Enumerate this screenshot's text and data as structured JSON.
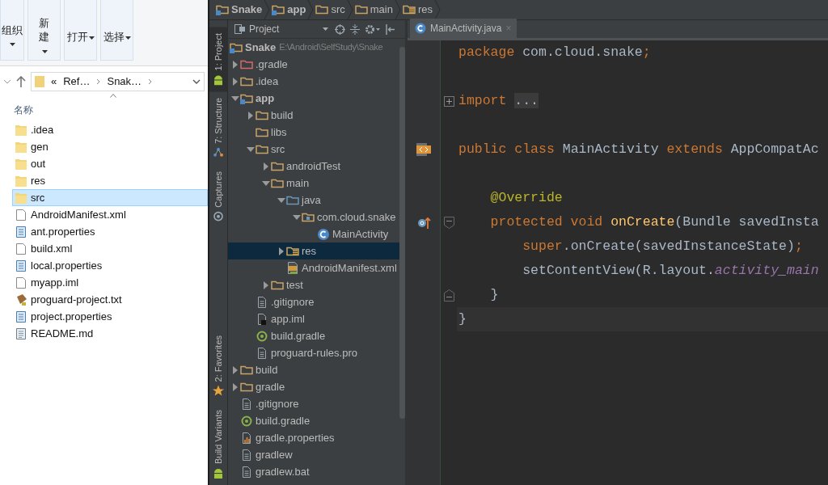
{
  "explorer": {
    "ribbon": [
      {
        "label": "组织"
      },
      {
        "label": "新建"
      },
      {
        "label": "打开"
      },
      {
        "label": "选择"
      }
    ],
    "address": {
      "prefix": "«",
      "parts": [
        "Ref…",
        "Snak…"
      ]
    },
    "column_header": "名称",
    "files": [
      {
        "name": ".idea",
        "kind": "folder",
        "selected": false
      },
      {
        "name": "gen",
        "kind": "folder",
        "selected": false
      },
      {
        "name": "out",
        "kind": "folder",
        "selected": false
      },
      {
        "name": "res",
        "kind": "folder",
        "selected": false
      },
      {
        "name": "src",
        "kind": "folder",
        "selected": true
      },
      {
        "name": "AndroidManifest.xml",
        "kind": "file",
        "selected": false
      },
      {
        "name": "ant.properties",
        "kind": "settings",
        "selected": false
      },
      {
        "name": "build.xml",
        "kind": "file",
        "selected": false
      },
      {
        "name": "local.properties",
        "kind": "settings",
        "selected": false
      },
      {
        "name": "myapp.iml",
        "kind": "file",
        "selected": false
      },
      {
        "name": "proguard-project.txt",
        "kind": "script",
        "selected": false
      },
      {
        "name": "project.properties",
        "kind": "settings",
        "selected": false
      },
      {
        "name": "README.md",
        "kind": "text",
        "selected": false
      }
    ]
  },
  "ide": {
    "breadcrumbs": [
      {
        "label": "Snake",
        "kind": "module"
      },
      {
        "label": "app",
        "kind": "module"
      },
      {
        "label": "src",
        "kind": "folder"
      },
      {
        "label": "main",
        "kind": "folder"
      },
      {
        "label": "res",
        "kind": "res"
      }
    ],
    "tool_tabs": [
      {
        "label": "1: Project",
        "selected": true
      },
      {
        "label": "7: Structure",
        "selected": false
      },
      {
        "label": "Captures",
        "selected": false
      },
      {
        "label": "2: Favorites",
        "selected": false
      },
      {
        "label": "Build Variants",
        "selected": false
      }
    ],
    "project_view": {
      "title": "Project",
      "tree": [
        {
          "label": "Snake",
          "path": "E:\\Android\\SelfStudy\\Snake",
          "kind": "module",
          "selected": false,
          "children": [
            {
              "label": ".gradle",
              "kind": "excluded",
              "expanded": false,
              "selected": false
            },
            {
              "label": ".idea",
              "kind": "folder",
              "expanded": false,
              "selected": false
            },
            {
              "label": "app",
              "kind": "module",
              "expanded": true,
              "selected": false,
              "children": [
                {
                  "label": "build",
                  "kind": "folder",
                  "expanded": false,
                  "selected": false
                },
                {
                  "label": "libs",
                  "kind": "folder",
                  "selected": false
                },
                {
                  "label": "src",
                  "kind": "folder",
                  "expanded": true,
                  "selected": false,
                  "children": [
                    {
                      "label": "androidTest",
                      "kind": "folder",
                      "expanded": false,
                      "selected": false
                    },
                    {
                      "label": "main",
                      "kind": "folder",
                      "expanded": true,
                      "selected": false,
                      "children": [
                        {
                          "label": "java",
                          "kind": "source",
                          "expanded": true,
                          "selected": false,
                          "children": [
                            {
                              "label": "com.cloud.snake",
                              "kind": "package",
                              "expanded": true,
                              "selected": false,
                              "children": [
                                {
                                  "label": "MainActivity",
                                  "kind": "class",
                                  "selected": false
                                }
                              ]
                            }
                          ]
                        },
                        {
                          "label": "res",
                          "kind": "res",
                          "expanded": false,
                          "selected": true
                        },
                        {
                          "label": "AndroidManifest.xml",
                          "kind": "manifest",
                          "selected": false
                        }
                      ]
                    },
                    {
                      "label": "test",
                      "kind": "folder",
                      "expanded": false,
                      "selected": false
                    }
                  ]
                },
                {
                  "label": ".gitignore",
                  "kind": "file",
                  "selected": false
                },
                {
                  "label": "app.iml",
                  "kind": "iml",
                  "selected": false
                },
                {
                  "label": "build.gradle",
                  "kind": "gradle",
                  "selected": false
                },
                {
                  "label": "proguard-rules.pro",
                  "kind": "file",
                  "selected": false
                }
              ]
            },
            {
              "label": "build",
              "kind": "folder",
              "expanded": false,
              "selected": false
            },
            {
              "label": "gradle",
              "kind": "folder",
              "expanded": false,
              "selected": false
            },
            {
              "label": ".gitignore",
              "kind": "file",
              "selected": false
            },
            {
              "label": "build.gradle",
              "kind": "gradle",
              "selected": false
            },
            {
              "label": "gradle.properties",
              "kind": "properties",
              "selected": false
            },
            {
              "label": "gradlew",
              "kind": "file",
              "selected": false
            },
            {
              "label": "gradlew.bat",
              "kind": "file",
              "selected": false
            }
          ]
        }
      ]
    },
    "editor": {
      "tabs": [
        {
          "label": "MainActivity.java",
          "close": "×",
          "selected": true
        }
      ],
      "lines": [
        {
          "kind": "code",
          "current": false,
          "tokens": [
            {
              "text": "package",
              "kind": "keyword"
            },
            {
              "text": " com.cloud.snake",
              "kind": "plain"
            },
            {
              "text": ";",
              "kind": "keyword"
            }
          ]
        },
        {
          "kind": "blank"
        },
        {
          "kind": "code",
          "current": false,
          "tokens": [
            {
              "text": "import ",
              "kind": "keyword"
            },
            {
              "text": "...",
              "kind": "folded"
            }
          ]
        },
        {
          "kind": "blank"
        },
        {
          "kind": "code",
          "current": false,
          "tokens": [
            {
              "text": "public class ",
              "kind": "keyword"
            },
            {
              "text": "MainActivity ",
              "kind": "plain"
            },
            {
              "text": "extends ",
              "kind": "keyword"
            },
            {
              "text": "AppCompatAc",
              "kind": "plain"
            }
          ]
        },
        {
          "kind": "blank"
        },
        {
          "kind": "code",
          "current": false,
          "tokens": [
            {
              "text": "    @Override",
              "kind": "annotation"
            }
          ]
        },
        {
          "kind": "code",
          "current": false,
          "tokens": [
            {
              "text": "    protected void ",
              "kind": "keyword"
            },
            {
              "text": "onCreate",
              "kind": "method"
            },
            {
              "text": "(Bundle savedInsta",
              "kind": "plain"
            }
          ]
        },
        {
          "kind": "code",
          "current": false,
          "tokens": [
            {
              "text": "        super",
              "kind": "keyword"
            },
            {
              "text": ".onCreate(savedInstanceState)",
              "kind": "plain"
            },
            {
              "text": ";",
              "kind": "keyword"
            }
          ]
        },
        {
          "kind": "code",
          "current": false,
          "tokens": [
            {
              "text": "        setContentView(R.layout.",
              "kind": "plain"
            },
            {
              "text": "activity_main",
              "kind": "field"
            }
          ]
        },
        {
          "kind": "code",
          "current": false,
          "tokens": [
            {
              "text": "    }",
              "kind": "plain"
            }
          ]
        },
        {
          "kind": "code",
          "current": true,
          "tokens": [
            {
              "text": "}",
              "kind": "plain"
            }
          ]
        }
      ]
    }
  }
}
